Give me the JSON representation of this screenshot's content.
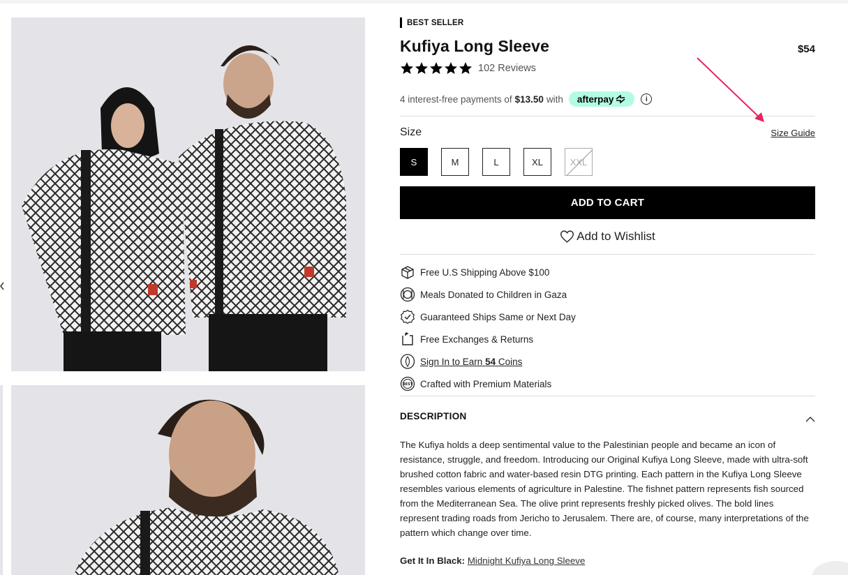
{
  "product": {
    "badge": "BEST SELLER",
    "title": "Kufiya Long Sleeve",
    "price": "$54",
    "rating": {
      "stars": 5,
      "reviews_label": "102 Reviews"
    },
    "afterpay": {
      "prefix": "4 interest-free payments of",
      "amount": "$13.50",
      "suffix": "with",
      "logo_text": "afterpay",
      "info_glyph": "i"
    },
    "size": {
      "label": "Size",
      "guide_label": "Size Guide",
      "options": [
        {
          "label": "S",
          "state": "selected"
        },
        {
          "label": "M",
          "state": "available"
        },
        {
          "label": "L",
          "state": "available"
        },
        {
          "label": "XL",
          "state": "available"
        },
        {
          "label": "XXL",
          "state": "sold-out"
        }
      ]
    },
    "add_to_cart_label": "ADD TO CART",
    "wishlist_label": "Add to Wishlist",
    "features": [
      {
        "icon": "box-icon",
        "text": "Free U.S Shipping Above $100"
      },
      {
        "icon": "meals-icon",
        "text": "Meals Donated to Children in Gaza"
      },
      {
        "icon": "check-badge-icon",
        "text": "Guaranteed Ships Same or Next Day"
      },
      {
        "icon": "exchange-icon",
        "text": "Free Exchanges & Returns"
      },
      {
        "icon": "coin-icon",
        "link_prefix": "Sign In to Earn",
        "link_bold": "54",
        "link_suffix": "Coins"
      },
      {
        "icon": "quality-seal-icon",
        "text": "Crafted with Premium Materials"
      }
    ],
    "description": {
      "heading": "DESCRIPTION",
      "body": "The Kufiya holds a deep sentimental value to the Palestinian people and became an icon of resistance, struggle, and freedom. Introducing our Original Kufiya Long Sleeve, made with ultra-soft brushed cotton fabric and water-based resin DTG printing. Each pattern in the Kufiya Long Sleeve resembles various elements of agriculture in Palestine. The fishnet pattern represents fish sourced from the Mediterranean Sea. The olive print represents freshly picked olives. The bold lines represent trading roads from Jericho to Jerusalem. There are, of course, many interpretations of the pattern which change over time.",
      "black_label": "Get It In Black:",
      "black_link": "Midnight Kufiya Long Sleeve"
    }
  },
  "colors": {
    "accent": "#000000",
    "afterpay_mint": "#b2fce4",
    "annotation_arrow": "#e8245e",
    "photo_bg": "#e6e6ea"
  }
}
